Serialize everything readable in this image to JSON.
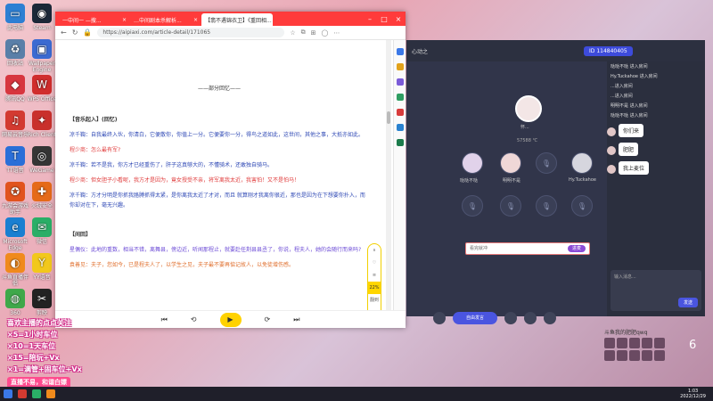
{
  "desktop": {
    "icons": [
      {
        "label": "此电脑",
        "color": "#2d7fd3",
        "glyph": "▭"
      },
      {
        "label": "Steam",
        "color": "#1b2838",
        "glyph": "◉"
      },
      {
        "label": "回收站",
        "color": "#5a7fa8",
        "glyph": "♻"
      },
      {
        "label": "Wallpaper Engine",
        "color": "#3b6ad1",
        "glyph": "▣"
      },
      {
        "label": "腾讯QQ",
        "color": "#d7363f",
        "glyph": "◆"
      },
      {
        "label": "WPS Office",
        "color": "#d02d2d",
        "glyph": "W"
      },
      {
        "label": "网易云音乐",
        "color": "#d33a31",
        "glyph": "♫"
      },
      {
        "label": "Rich Client",
        "color": "#c9302c",
        "glyph": "✦"
      },
      {
        "label": "TT语音",
        "color": "#2a6fd8",
        "glyph": "T"
      },
      {
        "label": "WeGame",
        "color": "#353535",
        "glyph": "◎"
      },
      {
        "label": "九游会游戏助手",
        "color": "#e1531e",
        "glyph": "✪"
      },
      {
        "label": "火绒安全",
        "color": "#e56a19",
        "glyph": "✚"
      },
      {
        "label": "Microsoft Edge",
        "color": "#1a7fd1",
        "glyph": "e"
      },
      {
        "label": "微信",
        "color": "#2aae67",
        "glyph": "✉"
      },
      {
        "label": "斗鱼直播伴侣",
        "color": "#f08a1c",
        "glyph": "◐"
      },
      {
        "label": "YY语音",
        "color": "#f2c81c",
        "glyph": "Y"
      },
      {
        "label": "360",
        "color": "#3fa84a",
        "glyph": "◍"
      },
      {
        "label": "剪映",
        "color": "#222",
        "glyph": "✂"
      }
    ]
  },
  "browser": {
    "tabs": [
      {
        "label": "一中间一 —搜...",
        "active": false
      },
      {
        "label": "…中间剧本杀解析...",
        "active": false
      },
      {
        "label": "【翡不遇锦衣卫】《重回相...",
        "active": true
      }
    ],
    "url": "https://aipiaxi.com/article-detail/171065",
    "article": {
      "divider": "——部分回忆——",
      "section1": "【音乐起入】(回忆)",
      "lines": [
        {
          "speaker": "凉千鞫：",
          "text": "自我最终入伙，你清白，它便散你，你值上一分。它便要你一分，得鸟之道如此，这世间，其他之事，大抵亦如此。",
          "color": "blue"
        },
        {
          "speaker": "程少商：",
          "text": "怎么最有军?",
          "color": "red"
        },
        {
          "speaker": "凉千鞫：",
          "text": "若不是我，你方才已经重伤了，肝子这真够大的，不懂骑术，还敢独自骑马。",
          "color": "blue"
        },
        {
          "speaker": "程少商：",
          "text": "但女胆子小看呢，我方才是因为，竟女授受不亲，将军离我太近，我害怕！又不是怕马！",
          "color": "red"
        },
        {
          "speaker": "凉千鞫：",
          "text": "方才分明是你抓我胳膊抓得太紧，是你离我太近了才对，而且 就算刚才我离你很近，那也是因为在下想要你扑入，而你却对在下，毫无兴趣。",
          "color": "blue"
        }
      ],
      "section2": "【间回】",
      "lines2": [
        {
          "speaker": "星偶仪：",
          "text": "此地的重数，相当不错，离舞县，傍边近，听闻那程止，就要赴任荆县县丞了，你说，程夫人，她的会随行而来吗?",
          "color": "purple"
        },
        {
          "speaker": "袁善见：",
          "text": "夫子，您如今，已是程夫人了，以学生之见，夫子最不要再惦记故人，以免徒增伤感。",
          "color": "orange"
        }
      ]
    },
    "side_float": {
      "pct": "22%",
      "label": "翻到"
    }
  },
  "voice_app": {
    "title": "心动之",
    "room_id": "114840405",
    "host_name": "怀...",
    "fans": "57588 ℃",
    "seats": [
      {
        "name": "哒哒不哒"
      },
      {
        "name": "明明不是"
      },
      {
        "name": ""
      },
      {
        "name": "Hy.Tuckahoe"
      }
    ],
    "input_placeholder": "看完就冲",
    "input_button": "进麦",
    "bottom_main": "自由发言",
    "chat_lines": [
      "哒哒不哒  进入房间",
      "Hy.Tuckahoe  进入房间",
      "...进入房间",
      "...进入房间",
      "明明不是  进入房间",
      "哒哒不哒  进入房间"
    ],
    "bubbles": [
      "你们来",
      "肥肥",
      "我上麦位"
    ],
    "chat_placeholder": "输入消息...",
    "send": "发送"
  },
  "viewers": {
    "label": "斗鱼我的肥肥qwq",
    "count": "6"
  },
  "overlay": {
    "lines": [
      "喜欢主播的点点关注",
      "×5=1小时车位",
      "×10=1天车位",
      "×15=陪玩+Vx",
      "×1=满管+固车位+Vx"
    ],
    "banner": "直播不易，和谐白嫖"
  },
  "taskbar": {
    "time": "1:03",
    "date": "2022/12/29"
  },
  "colors": {
    "tabbar": "#ff3b3b",
    "voice_bg": "#2c3040",
    "accent": "#4a55e0"
  }
}
